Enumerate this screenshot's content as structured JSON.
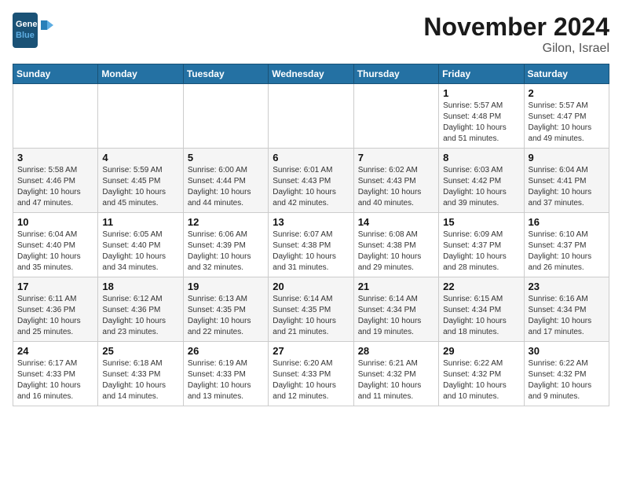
{
  "header": {
    "logo_line1": "General",
    "logo_line2": "Blue",
    "month_title": "November 2024",
    "location": "Gilon, Israel"
  },
  "days_of_week": [
    "Sunday",
    "Monday",
    "Tuesday",
    "Wednesday",
    "Thursday",
    "Friday",
    "Saturday"
  ],
  "weeks": [
    [
      {
        "day": "",
        "info": ""
      },
      {
        "day": "",
        "info": ""
      },
      {
        "day": "",
        "info": ""
      },
      {
        "day": "",
        "info": ""
      },
      {
        "day": "",
        "info": ""
      },
      {
        "day": "1",
        "info": "Sunrise: 5:57 AM\nSunset: 4:48 PM\nDaylight: 10 hours\nand 51 minutes."
      },
      {
        "day": "2",
        "info": "Sunrise: 5:57 AM\nSunset: 4:47 PM\nDaylight: 10 hours\nand 49 minutes."
      }
    ],
    [
      {
        "day": "3",
        "info": "Sunrise: 5:58 AM\nSunset: 4:46 PM\nDaylight: 10 hours\nand 47 minutes."
      },
      {
        "day": "4",
        "info": "Sunrise: 5:59 AM\nSunset: 4:45 PM\nDaylight: 10 hours\nand 45 minutes."
      },
      {
        "day": "5",
        "info": "Sunrise: 6:00 AM\nSunset: 4:44 PM\nDaylight: 10 hours\nand 44 minutes."
      },
      {
        "day": "6",
        "info": "Sunrise: 6:01 AM\nSunset: 4:43 PM\nDaylight: 10 hours\nand 42 minutes."
      },
      {
        "day": "7",
        "info": "Sunrise: 6:02 AM\nSunset: 4:43 PM\nDaylight: 10 hours\nand 40 minutes."
      },
      {
        "day": "8",
        "info": "Sunrise: 6:03 AM\nSunset: 4:42 PM\nDaylight: 10 hours\nand 39 minutes."
      },
      {
        "day": "9",
        "info": "Sunrise: 6:04 AM\nSunset: 4:41 PM\nDaylight: 10 hours\nand 37 minutes."
      }
    ],
    [
      {
        "day": "10",
        "info": "Sunrise: 6:04 AM\nSunset: 4:40 PM\nDaylight: 10 hours\nand 35 minutes."
      },
      {
        "day": "11",
        "info": "Sunrise: 6:05 AM\nSunset: 4:40 PM\nDaylight: 10 hours\nand 34 minutes."
      },
      {
        "day": "12",
        "info": "Sunrise: 6:06 AM\nSunset: 4:39 PM\nDaylight: 10 hours\nand 32 minutes."
      },
      {
        "day": "13",
        "info": "Sunrise: 6:07 AM\nSunset: 4:38 PM\nDaylight: 10 hours\nand 31 minutes."
      },
      {
        "day": "14",
        "info": "Sunrise: 6:08 AM\nSunset: 4:38 PM\nDaylight: 10 hours\nand 29 minutes."
      },
      {
        "day": "15",
        "info": "Sunrise: 6:09 AM\nSunset: 4:37 PM\nDaylight: 10 hours\nand 28 minutes."
      },
      {
        "day": "16",
        "info": "Sunrise: 6:10 AM\nSunset: 4:37 PM\nDaylight: 10 hours\nand 26 minutes."
      }
    ],
    [
      {
        "day": "17",
        "info": "Sunrise: 6:11 AM\nSunset: 4:36 PM\nDaylight: 10 hours\nand 25 minutes."
      },
      {
        "day": "18",
        "info": "Sunrise: 6:12 AM\nSunset: 4:36 PM\nDaylight: 10 hours\nand 23 minutes."
      },
      {
        "day": "19",
        "info": "Sunrise: 6:13 AM\nSunset: 4:35 PM\nDaylight: 10 hours\nand 22 minutes."
      },
      {
        "day": "20",
        "info": "Sunrise: 6:14 AM\nSunset: 4:35 PM\nDaylight: 10 hours\nand 21 minutes."
      },
      {
        "day": "21",
        "info": "Sunrise: 6:14 AM\nSunset: 4:34 PM\nDaylight: 10 hours\nand 19 minutes."
      },
      {
        "day": "22",
        "info": "Sunrise: 6:15 AM\nSunset: 4:34 PM\nDaylight: 10 hours\nand 18 minutes."
      },
      {
        "day": "23",
        "info": "Sunrise: 6:16 AM\nSunset: 4:34 PM\nDaylight: 10 hours\nand 17 minutes."
      }
    ],
    [
      {
        "day": "24",
        "info": "Sunrise: 6:17 AM\nSunset: 4:33 PM\nDaylight: 10 hours\nand 16 minutes."
      },
      {
        "day": "25",
        "info": "Sunrise: 6:18 AM\nSunset: 4:33 PM\nDaylight: 10 hours\nand 14 minutes."
      },
      {
        "day": "26",
        "info": "Sunrise: 6:19 AM\nSunset: 4:33 PM\nDaylight: 10 hours\nand 13 minutes."
      },
      {
        "day": "27",
        "info": "Sunrise: 6:20 AM\nSunset: 4:33 PM\nDaylight: 10 hours\nand 12 minutes."
      },
      {
        "day": "28",
        "info": "Sunrise: 6:21 AM\nSunset: 4:32 PM\nDaylight: 10 hours\nand 11 minutes."
      },
      {
        "day": "29",
        "info": "Sunrise: 6:22 AM\nSunset: 4:32 PM\nDaylight: 10 hours\nand 10 minutes."
      },
      {
        "day": "30",
        "info": "Sunrise: 6:22 AM\nSunset: 4:32 PM\nDaylight: 10 hours\nand 9 minutes."
      }
    ]
  ]
}
